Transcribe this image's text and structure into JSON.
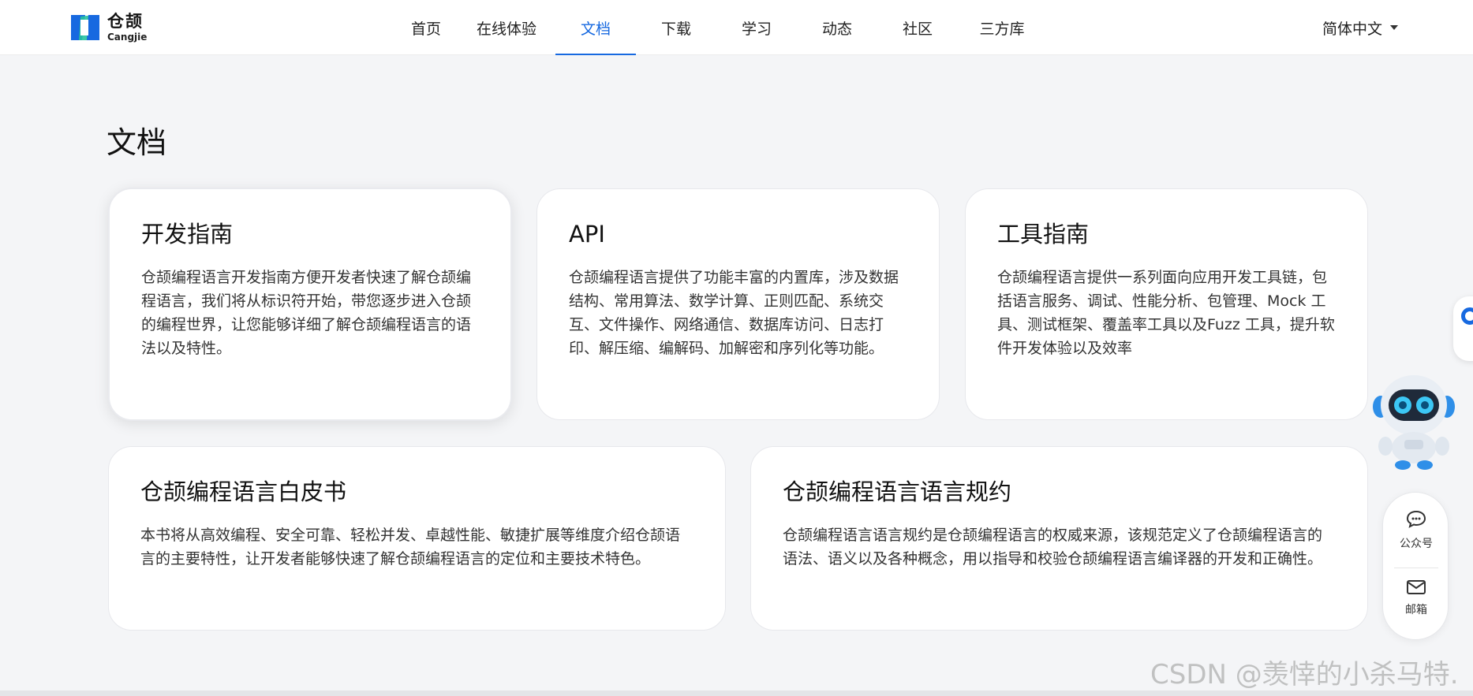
{
  "header": {
    "logo_cn": "仓颉",
    "logo_en": "Cangjie",
    "nav": [
      {
        "label": "首页",
        "active": false
      },
      {
        "label": "在线体验",
        "active": false
      },
      {
        "label": "文档",
        "active": true
      },
      {
        "label": "下载",
        "active": false
      },
      {
        "label": "学习",
        "active": false
      },
      {
        "label": "动态",
        "active": false
      },
      {
        "label": "社区",
        "active": false
      },
      {
        "label": "三方库",
        "active": false
      }
    ],
    "language": "简体中文"
  },
  "page": {
    "title": "文档"
  },
  "cards": [
    {
      "title": "开发指南",
      "desc": "仓颉编程语言开发指南方便开发者快速了解仓颉编程语言，我们将从标识符开始，带您逐步进入仓颉的编程世界，让您能够详细了解仓颉编程语言的语法以及特性。"
    },
    {
      "title": "API",
      "desc": "仓颉编程语言提供了功能丰富的内置库，涉及数据结构、常用算法、数学计算、正则匹配、系统交互、文件操作、网络通信、数据库访问、日志打印、解压缩、编解码、加解密和序列化等功能。"
    },
    {
      "title": "工具指南",
      "desc": "仓颉编程语言提供一系列面向应用开发工具链，包括语言服务、调试、性能分析、包管理、Mock 工具、测试框架、覆盖率工具以及Fuzz 工具，提升软件开发体验以及效率"
    },
    {
      "title": "仓颉编程语言白皮书",
      "desc": "本书将从高效编程、安全可靠、轻松并发、卓越性能、敏捷扩展等维度介绍仓颉语言的主要特性，让开发者能够快速了解仓颉编程语言的定位和主要技术特色。"
    },
    {
      "title": "仓颉编程语言语言规约",
      "desc": "仓颉编程语言语言规约是仓颉编程语言的权威来源，该规范定义了仓颉编程语言的语法、语义以及各种概念，用以指导和校验仓颉编程语言编译器的开发和正确性。"
    }
  ],
  "contact": {
    "wechat_label": "公众号",
    "mail_label": "邮箱"
  },
  "watermark": "CSDN @羡悻的小杀马特.",
  "colors": {
    "accent": "#1769e0",
    "background": "#f4f5f7",
    "card": "#ffffff"
  }
}
